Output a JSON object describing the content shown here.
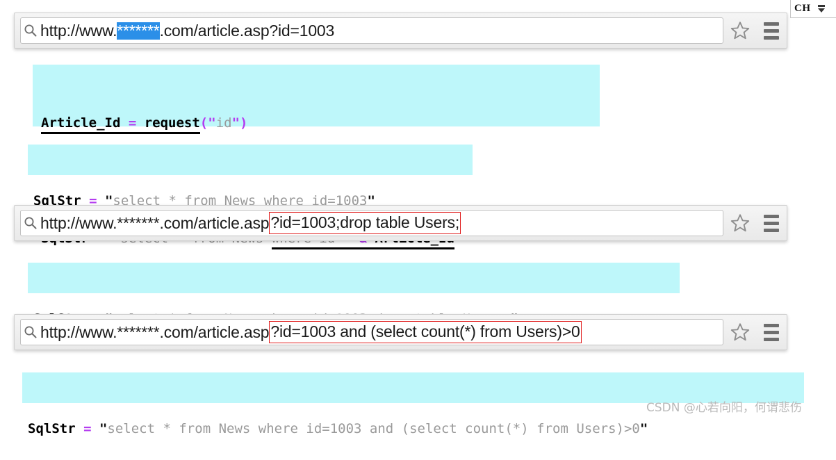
{
  "ime": {
    "label": "CH",
    "caret_icon": "chevron-down-icon"
  },
  "urlbars": [
    {
      "id": "urlbar-1",
      "search_icon": "search-icon",
      "prefix": "http://www.",
      "masked_host": "*******",
      "suffix": ".com/article.asp?id=1003",
      "injected": "",
      "star_icon": "star-bookmark-icon",
      "menu_icon": "hamburger-menu-icon"
    },
    {
      "id": "urlbar-2",
      "search_icon": "search-icon",
      "prefix": "http://www.*******.com/article.asp",
      "masked_host": "",
      "suffix": "",
      "injected": "?id=1003;drop table Users;",
      "star_icon": "star-bookmark-icon",
      "menu_icon": "hamburger-menu-icon"
    },
    {
      "id": "urlbar-3",
      "search_icon": "search-icon",
      "prefix": "http://www.*******.com/article.asp",
      "masked_host": "",
      "suffix": "",
      "injected": "?id=1003 and (select count(*) from Users)>0",
      "star_icon": "star-bookmark-icon",
      "menu_icon": "hamburger-menu-icon"
    }
  ],
  "code": {
    "block1_line1": {
      "ident1": "Article_Id",
      "op1": " = ",
      "ident2": "request",
      "paren_open": "(",
      "quote_open": "\"",
      "str": "id",
      "quote_close": "\"",
      "paren_close": ")"
    },
    "block1_line2": {
      "ident1": "SqlStr",
      "op1": " = ",
      "quote_open": "\"",
      "str_plain": "select * from News ",
      "str_underlined": "where id=",
      "quote_close": "\"",
      "amp": " & ",
      "ident2": "Article_Id"
    },
    "block2_line1": {
      "ident1": "SqlStr",
      "op1": " = ",
      "quote_open": "\"",
      "str_plain": "select * from News ",
      "str_underlined": "where id=1003",
      "quote_close": "\""
    },
    "block3_line1": {
      "ident1": "SqlStr",
      "op1": " = ",
      "quote_open": "\"",
      "str_plain": "select * from News where id=1003",
      "str_underlined": ";drop table Users;",
      "quote_close": "\""
    },
    "block4_line1": {
      "ident1": "SqlStr",
      "op1": " = ",
      "quote_open": "\"",
      "str_plain": "select * from News where id=1003 and (select count(*) from Users)>0",
      "quote_close": "\""
    }
  },
  "watermark": {
    "text": "CSDN @心若向阳，何谓悲伤"
  },
  "colors": {
    "code_background": "#bef7fa",
    "operator": "#b43cf0",
    "string_text": "#9a9a9a",
    "selection_highlight": "#2b8fe8",
    "injection_box_border": "#e01b1b",
    "page_background": "#ffffff"
  }
}
